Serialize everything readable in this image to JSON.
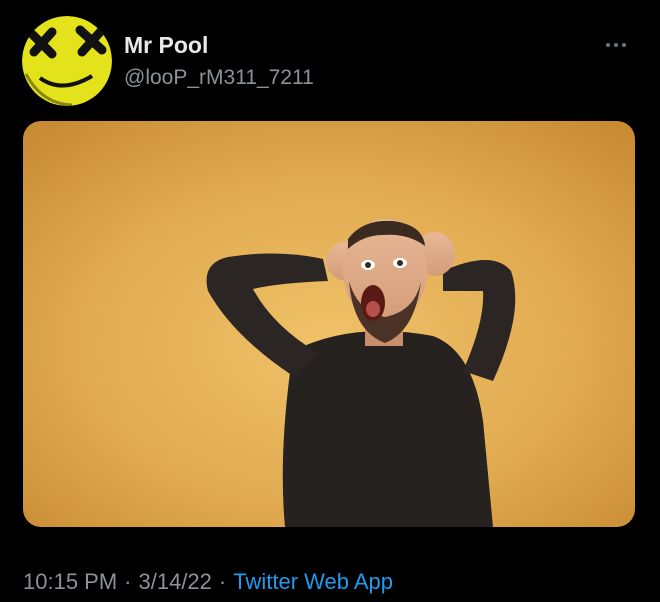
{
  "tweet": {
    "display_name": "Mr Pool",
    "handle": "@looP_rM311_7211",
    "more_icon": "more-horizontal-icon",
    "avatar_icon": "yellow-face-avatar",
    "media_description_icon": "surprised-man-photo",
    "meta": {
      "time": "10:15 PM",
      "separator": "·",
      "date": "3/14/22",
      "source": "Twitter Web App"
    },
    "colors": {
      "background": "#000000",
      "name": "#e7e9ea",
      "muted": "#8b9298",
      "link": "#1d9bf0",
      "avatar": "#e4e21a",
      "photo_bg": "#e3ad52"
    }
  }
}
